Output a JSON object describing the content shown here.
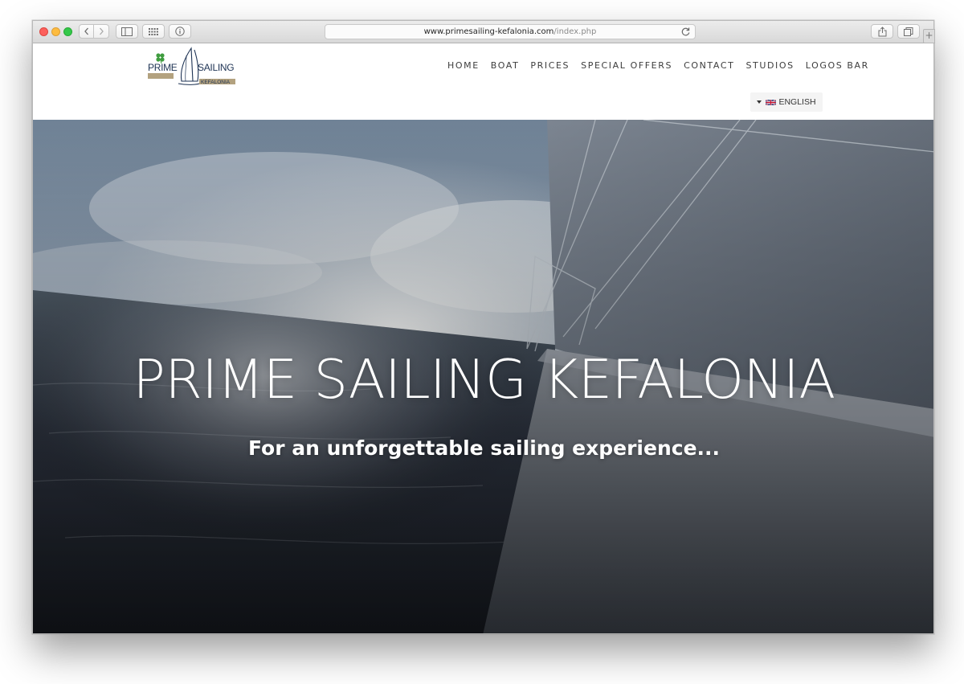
{
  "browser": {
    "url_domain": "www.primesailing-kefalonia.com",
    "url_path": "/index.php",
    "plus_tab": "+"
  },
  "icons": {
    "back": "chevron-left-icon",
    "forward": "chevron-right-icon",
    "sidebar": "sidebar-icon",
    "top_sites": "grid-icon",
    "info": "info-icon",
    "reload": "reload-icon",
    "share": "share-icon",
    "tabs": "tabs-icon",
    "language_flag": "uk-flag-icon"
  },
  "logo": {
    "line1": "PRIME",
    "line2": "SAILING",
    "line3": "KEFALONIA"
  },
  "nav": {
    "items": [
      {
        "label": "HOME"
      },
      {
        "label": "BOAT"
      },
      {
        "label": "PRICES"
      },
      {
        "label": "SPECIAL OFFERS"
      },
      {
        "label": "CONTACT"
      },
      {
        "label": "STUDIOS"
      },
      {
        "label": "LOGOS BAR"
      }
    ]
  },
  "language": {
    "selected": "ENGLISH"
  },
  "hero": {
    "title": "PRIME SAILING KEFALONIA",
    "subtitle": "For an unforgettable sailing experience..."
  },
  "colors": {
    "logo_green": "#3f9d3f",
    "logo_tan": "#b3a27f",
    "logo_navy": "#1e3354",
    "hero_text": "#ffffff",
    "nav_text": "#3d3d3d"
  }
}
